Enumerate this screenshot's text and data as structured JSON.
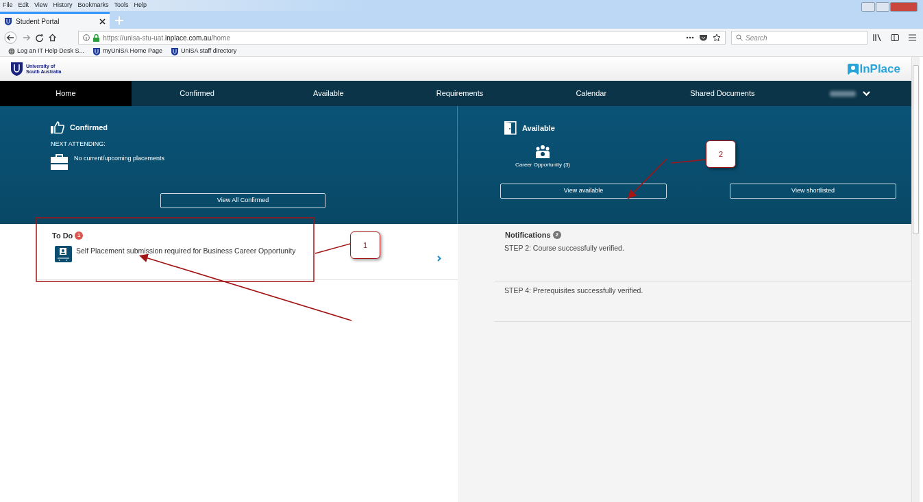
{
  "browser": {
    "menu": [
      "File",
      "Edit",
      "View",
      "History",
      "Bookmarks",
      "Tools",
      "Help"
    ],
    "tabs": [
      {
        "title": "Student Portal",
        "selected": true
      }
    ],
    "url": "https://unisa-stu-uat.**inplace.com.au**/home",
    "search": {
      "placeholder": "Search"
    },
    "bookmarks": [
      {
        "label": "Log an IT Help Desk S...",
        "kind": "globe"
      },
      {
        "label": "myUniSA Home Page",
        "kind": "shield"
      },
      {
        "label": "UniSA staff directory",
        "kind": "shield"
      }
    ]
  },
  "site": {
    "logo_lines": [
      "University of",
      "South Australia"
    ],
    "brand": "InPlace"
  },
  "nav": [
    {
      "label": "Home",
      "selected": true
    },
    {
      "label": "Confirmed",
      "selected": false
    },
    {
      "label": "Available",
      "selected": false
    },
    {
      "label": "Requirements",
      "selected": false
    },
    {
      "label": "Calendar",
      "selected": false
    },
    {
      "label": "Shared Documents",
      "selected": false
    }
  ],
  "confirmed": {
    "title": "Confirmed",
    "next_label": "NEXT ATTENDING:",
    "placement": "No current/upcoming placements",
    "button": "View All Confirmed"
  },
  "available": {
    "title": "Available",
    "opportunity": "Career Opportunity (3)",
    "buttons": [
      "View available",
      "View shortlisted"
    ]
  },
  "todo": {
    "title": "To Do",
    "count": "1",
    "items": [
      "Self Placement submission required for Business Career Opportunity"
    ]
  },
  "notifications": {
    "title": "Notifications",
    "count": "2",
    "items": [
      "STEP 2: Course successfully verified.",
      "STEP 4: Prerequisites successfully verified."
    ]
  },
  "annotations": [
    {
      "label": "1"
    },
    {
      "label": "2"
    }
  ]
}
